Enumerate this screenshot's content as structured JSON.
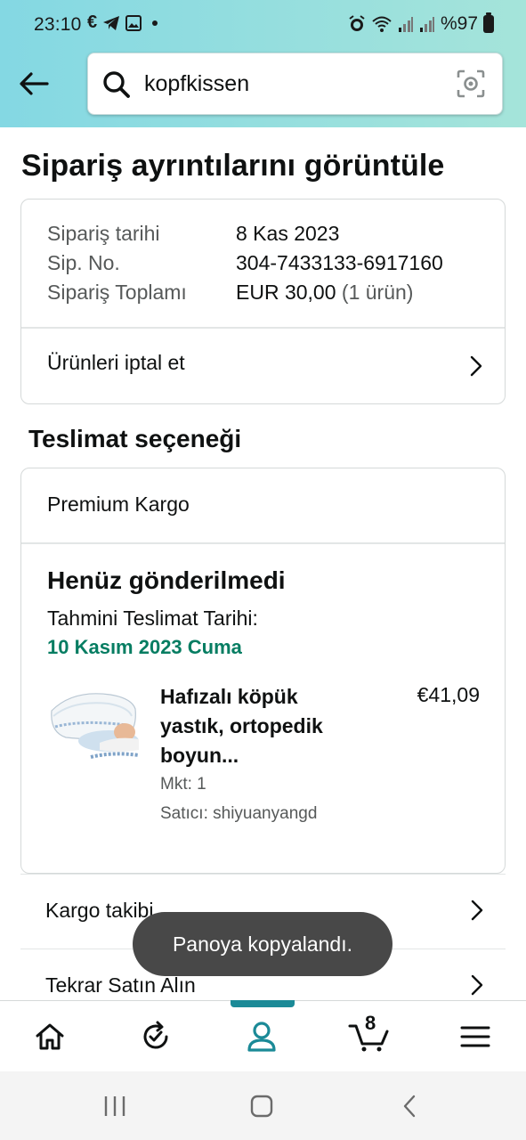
{
  "status_bar": {
    "time": "23:10",
    "battery_text": "%97"
  },
  "search": {
    "query": "kopfkissen"
  },
  "page_title": "Sipariş ayrıntılarını görüntüle",
  "order_summary": {
    "rows": [
      {
        "label": "Sipariş tarihi",
        "value": "8 Kas 2023",
        "extra": ""
      },
      {
        "label": "Sip. No.",
        "value": "304-7433133-6917160",
        "extra": ""
      },
      {
        "label": "Sipariş Toplamı",
        "value": "EUR 30,00",
        "extra": " (1 ürün)"
      }
    ],
    "cancel_label": "Ürünleri iptal et"
  },
  "delivery": {
    "section_title": "Teslimat seçeneği",
    "shipping_method": "Premium Kargo",
    "status_title": "Henüz gönderilmedi",
    "estimate_label": "Tahmini Teslimat Tarihi:",
    "estimate_date": "10 Kasım 2023 Cuma",
    "item": {
      "name": "Hafızalı köpük yastık, ortopedik boyun...",
      "price": "€41,09",
      "quantity": "Mkt: 1",
      "seller": "Satıcı: shiyuanyangd"
    }
  },
  "actions": {
    "track": "Kargo takibi",
    "buy_again": "Tekrar Satın Alın"
  },
  "toast": "Panoya kopyalandı.",
  "bottom_nav": {
    "cart_count": "8",
    "active_tab": "account",
    "accent_color": "#1b8a97"
  },
  "colors": {
    "header_gradient_start": "#84d8e3",
    "header_gradient_end": "#a5e4da",
    "delivery_date_green": "#067d62"
  }
}
